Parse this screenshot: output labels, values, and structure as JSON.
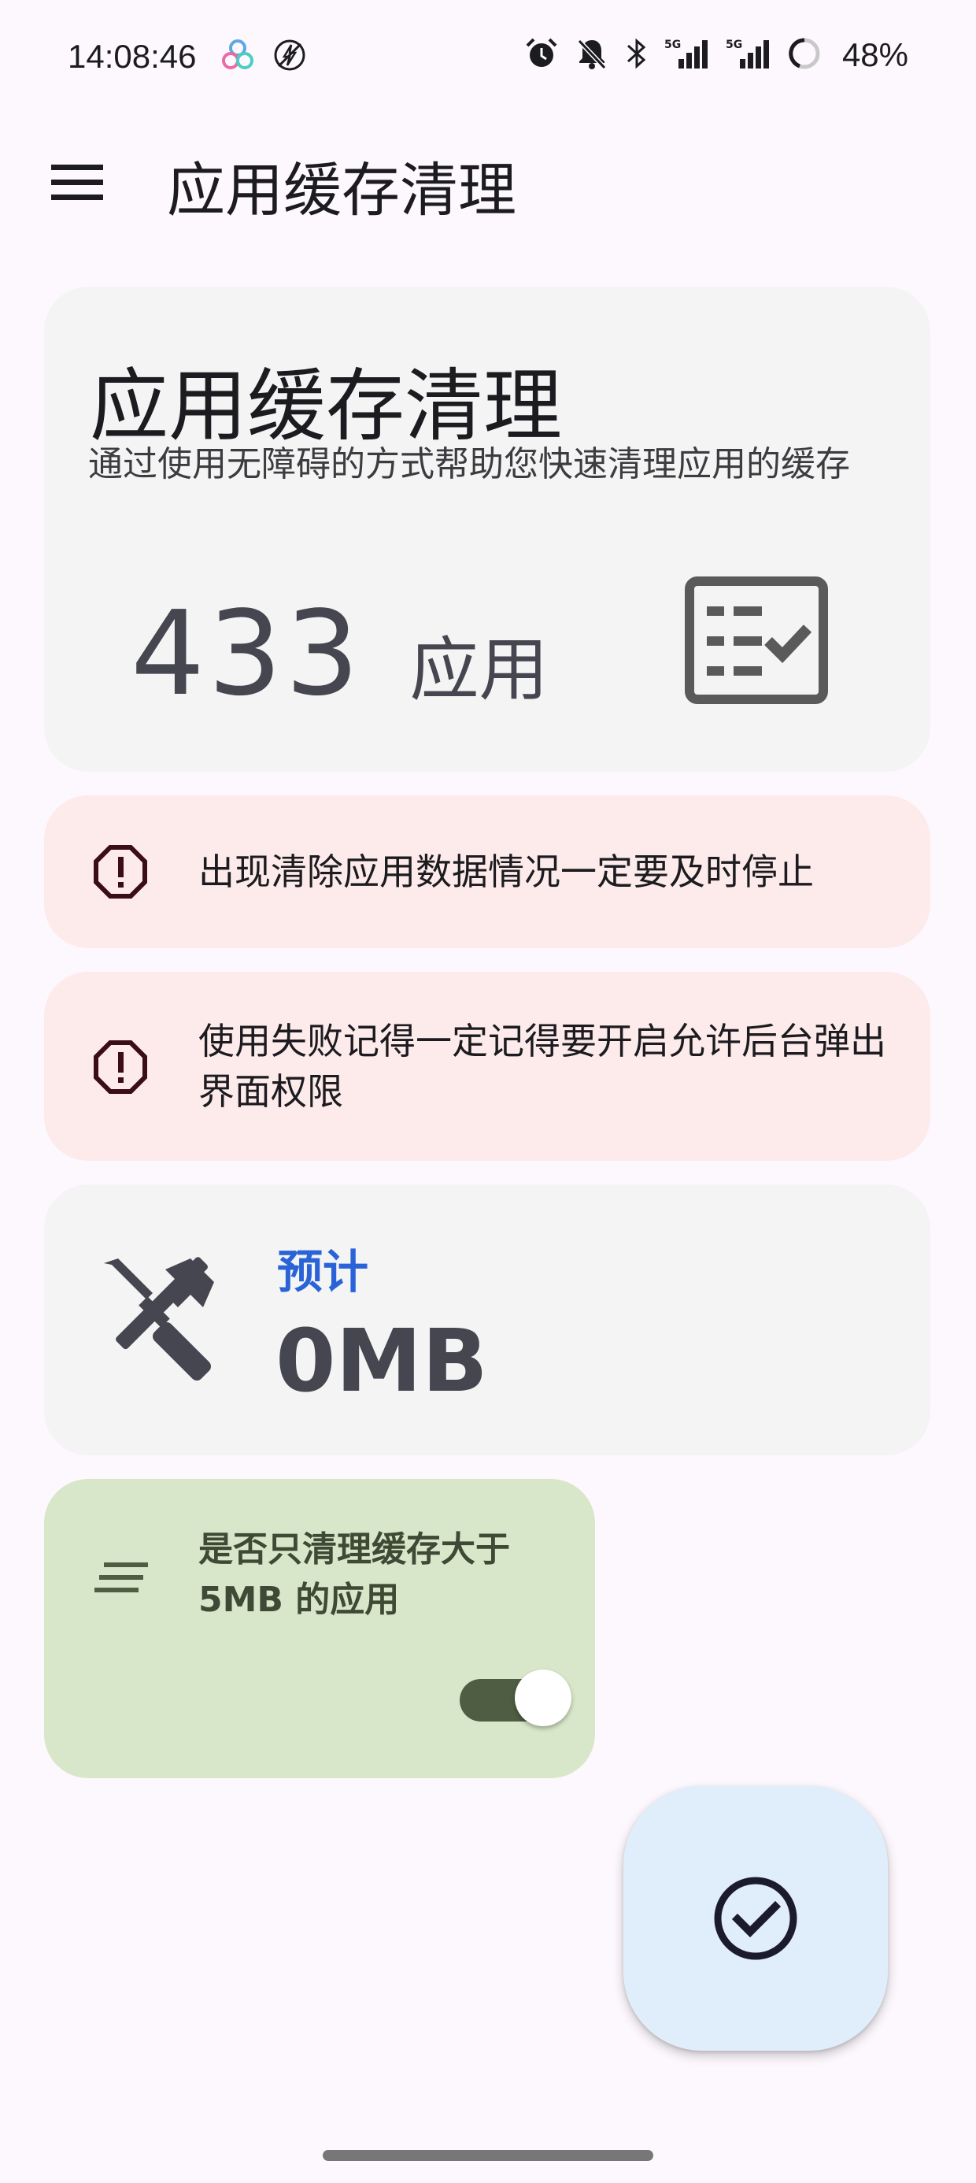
{
  "status_bar": {
    "time": "14:08:46",
    "battery": "48%",
    "sig1": "5G",
    "sig2": "5G",
    "icons": [
      "multi-circle-icon",
      "no-charge-icon",
      "alarm-icon",
      "bell-off-icon",
      "bluetooth-icon",
      "signal-5g-icon",
      "signal-5g-icon",
      "battery-ring-icon"
    ]
  },
  "app_bar": {
    "title": "应用缓存清理",
    "menu_icon": "menu-icon"
  },
  "summary": {
    "title": "应用缓存清理",
    "subtitle": "通过使用无障碍的方式帮助您快速清理应用的缓存",
    "count": "433",
    "count_unit": "应用",
    "icon": "checklist-icon"
  },
  "warnings": [
    {
      "text": "出现清除应用数据情况一定要及时停止",
      "icon": "warning-octagon-icon"
    },
    {
      "text": "使用失败记得一定记得要开启允许后台弹出界面权限",
      "icon": "warning-octagon-icon"
    }
  ],
  "estimate": {
    "label": "预计",
    "value": "0MB",
    "icon": "tools-icon"
  },
  "filter": {
    "text": "是否只清理缓存大于5MB 的应用",
    "enabled": true,
    "icon": "short-text-icon"
  },
  "fab": {
    "icon": "check-circle-icon"
  },
  "colors": {
    "background": "#fdf8fd",
    "card_neutral": "#f4f4f4",
    "card_warning": "#fdebeb",
    "card_filter": "#d8e7c9",
    "accent_blue": "#2a63d8",
    "fab": "#e0eefc"
  }
}
